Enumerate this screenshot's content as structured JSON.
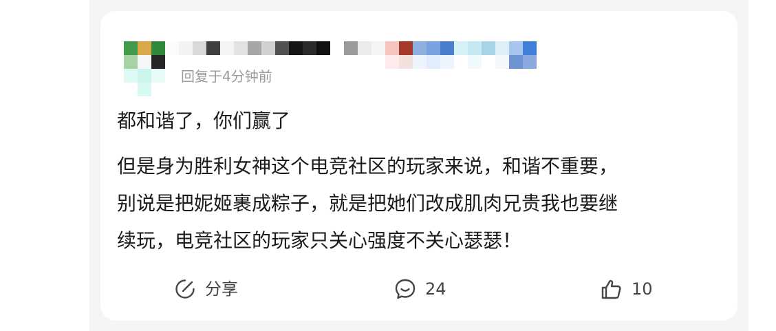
{
  "post": {
    "timestamp": "回复于4分钟前",
    "title": "都和谐了，你们赢了",
    "lines": [
      "但是身为胜利女神这个电竞社区的玩家来说，和谐不重要，",
      "别说是把妮姬裹成粽子，就是把她们改成肌肉兄贵我也要继",
      "续玩，电竞社区的玩家只关心强度不关心瑟瑟！"
    ]
  },
  "actions": {
    "share_label": "分享",
    "comment_count": "24",
    "like_count": "10"
  },
  "icons": {
    "share": "share-pencil-icon",
    "comment": "comment-bubble-icon",
    "like": "thumbs-up-icon"
  },
  "colors": {
    "background": "#f5f3f4",
    "card": "#ffffff",
    "text": "#1b1b1b",
    "meta": "#9a9a9a",
    "icon": "#444444"
  }
}
